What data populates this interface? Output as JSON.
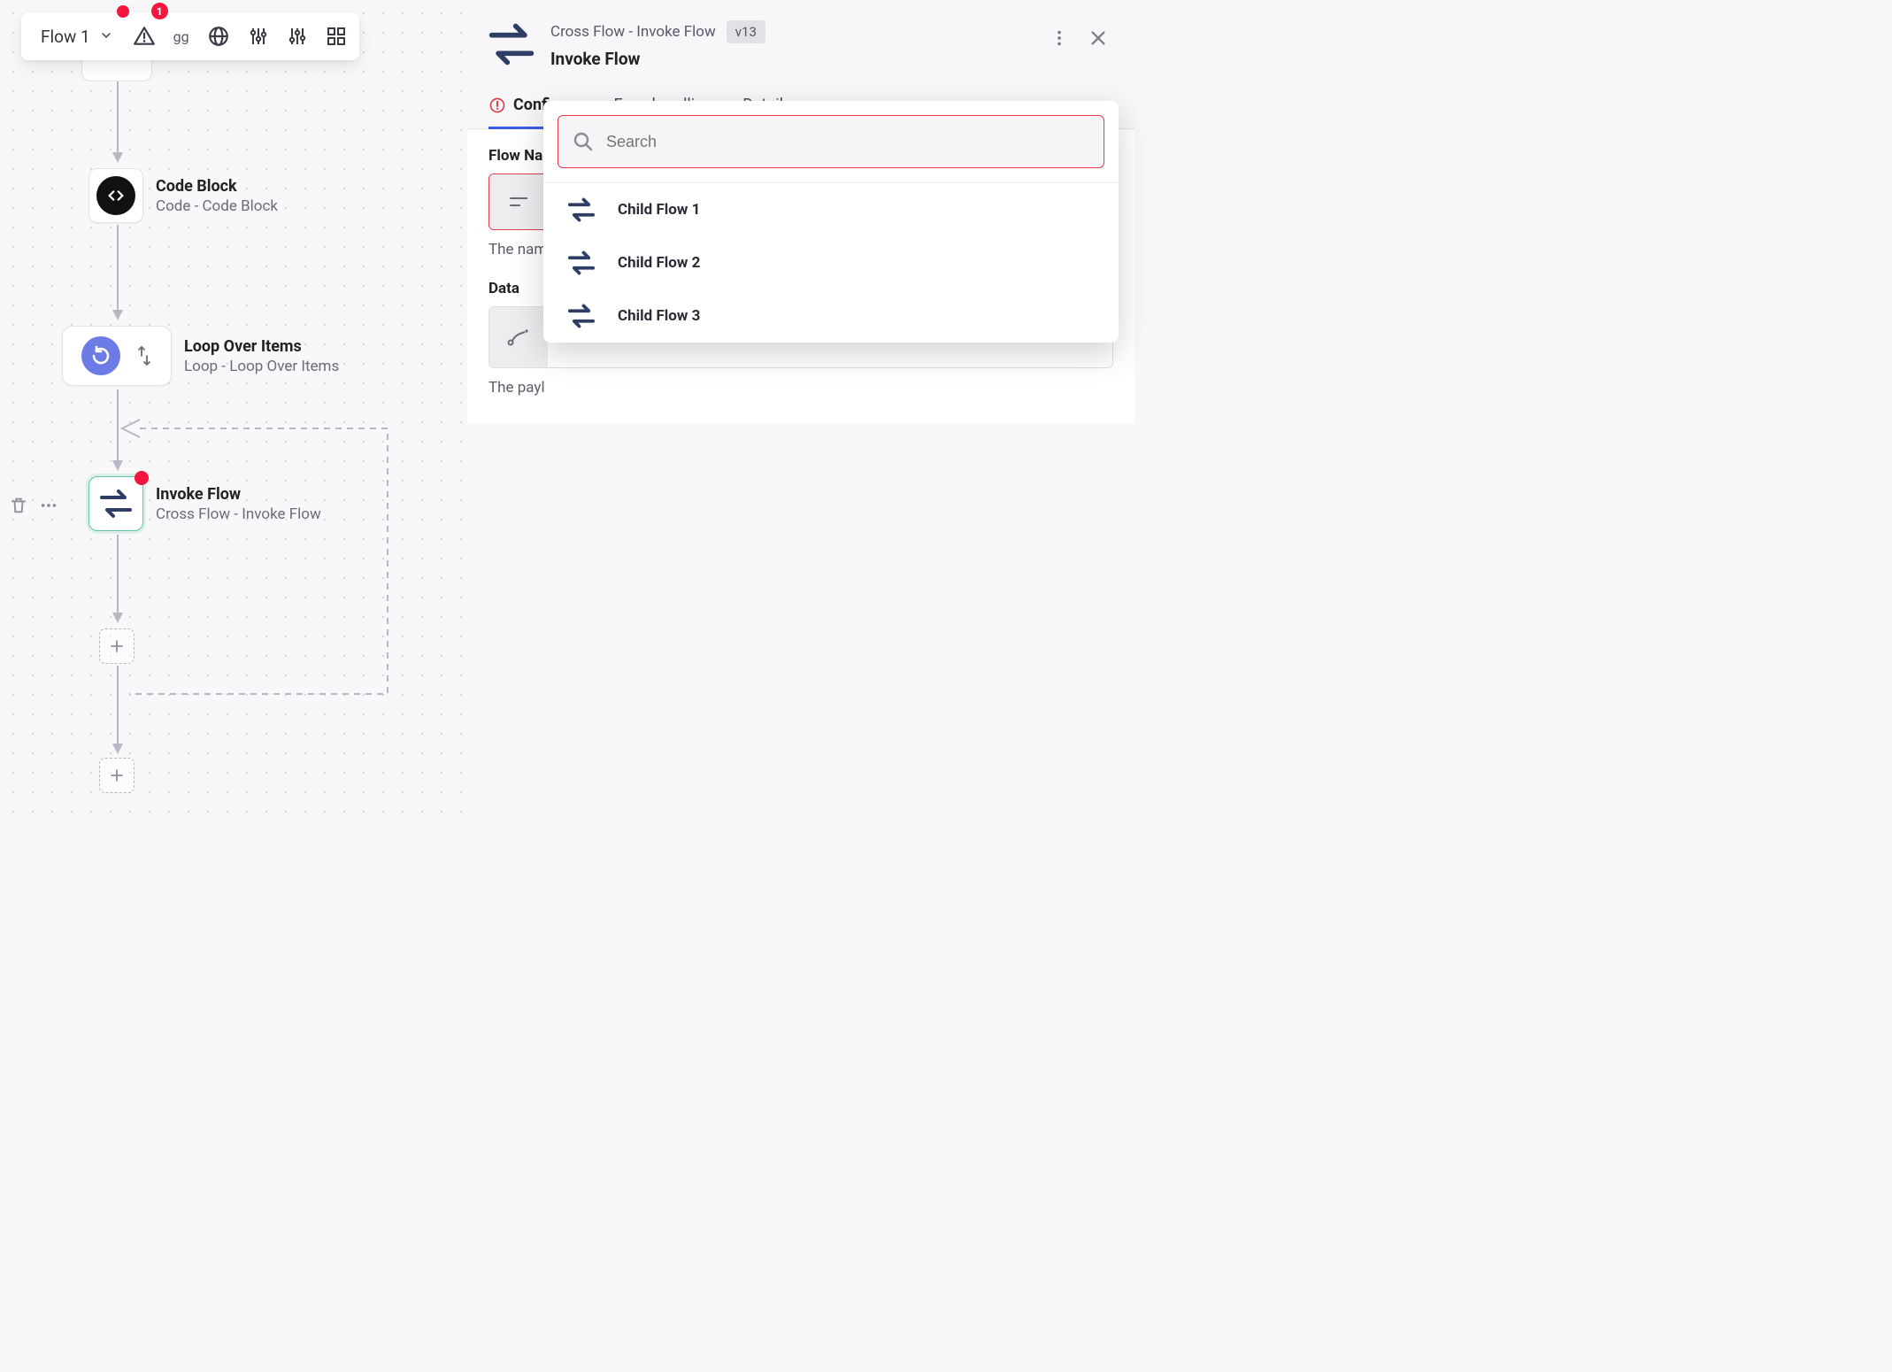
{
  "toolbar": {
    "flow_label": "Flow 1",
    "warning_badge": "1"
  },
  "nodes": {
    "code_block": {
      "title": "Code Block",
      "subtitle": "Code - Code Block"
    },
    "loop": {
      "title": "Loop Over Items",
      "subtitle": "Loop - Loop Over Items"
    },
    "invoke": {
      "title": "Invoke Flow",
      "subtitle": "Cross Flow - Invoke Flow"
    }
  },
  "panel": {
    "supertitle": "Cross Flow - Invoke Flow",
    "version": "v13",
    "title": "Invoke Flow",
    "tabs": {
      "configure": "Configure",
      "error": "Error handling",
      "details": "Details"
    },
    "flow_name_label": "Flow Name",
    "flow_name_hint": "The nam",
    "data_label": "Data",
    "data_hint": "The payl"
  },
  "dropdown": {
    "search_placeholder": "Search",
    "options": [
      "Child Flow 1",
      "Child Flow 2",
      "Child Flow 3"
    ]
  }
}
